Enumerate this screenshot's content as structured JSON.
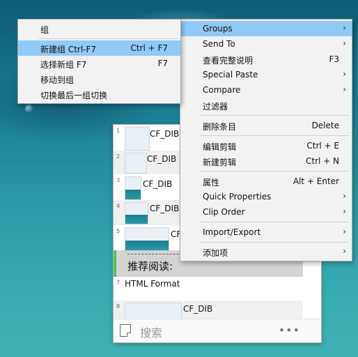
{
  "clip_window": {
    "rows": [
      {
        "index": "1",
        "format": "CF_DIB"
      },
      {
        "index": "2",
        "format": "CF_DIB"
      },
      {
        "index": "3",
        "format": "CF_DIB"
      },
      {
        "index": "4",
        "format": "CF_DIB"
      },
      {
        "index": "5",
        "format": "CF"
      },
      {
        "index": "7",
        "format": "HTML Format"
      },
      {
        "index": "8",
        "format": "CF_DIB"
      }
    ],
    "separator_text": "推荐阅读:",
    "search_label": "搜索",
    "more_label": "•••"
  },
  "groups_submenu": {
    "items": [
      {
        "label": "组",
        "shortcut": ""
      },
      {
        "label": "新建组 Ctrl-F7",
        "shortcut": "Ctrl + F7",
        "highlighted": true
      },
      {
        "label": "选择新组 F7",
        "shortcut": "F7"
      },
      {
        "label": "移动到组",
        "shortcut": ""
      },
      {
        "label": "切换最后一组切换",
        "shortcut": ""
      }
    ]
  },
  "context_menu": {
    "items": [
      {
        "label": "Groups",
        "has_submenu": true,
        "highlighted": true
      },
      {
        "label": "Send To",
        "has_submenu": true
      },
      {
        "label": "查看完整说明",
        "shortcut": "F3"
      },
      {
        "label": "Special Paste",
        "has_submenu": true
      },
      {
        "label": "Compare",
        "has_submenu": true
      },
      {
        "label": "过滤器"
      },
      {
        "label": "删除条目",
        "shortcut": "Delete"
      },
      {
        "label": "编辑剪辑",
        "shortcut": "Ctrl + E"
      },
      {
        "label": "新建剪辑",
        "shortcut": "Ctrl + N"
      },
      {
        "label": "属性",
        "shortcut": "Alt + Enter"
      },
      {
        "label": "Quick Properties",
        "has_submenu": true
      },
      {
        "label": "Clip Order",
        "has_submenu": true
      },
      {
        "label": "Import/Export",
        "has_submenu": true
      },
      {
        "label": "添加项",
        "has_submenu": true
      }
    ],
    "arrow_glyph": "›"
  },
  "colors": {
    "highlight": "#91c9f7",
    "menu_bg": "#f2f2f2",
    "separator_green": "#4fc44f"
  }
}
